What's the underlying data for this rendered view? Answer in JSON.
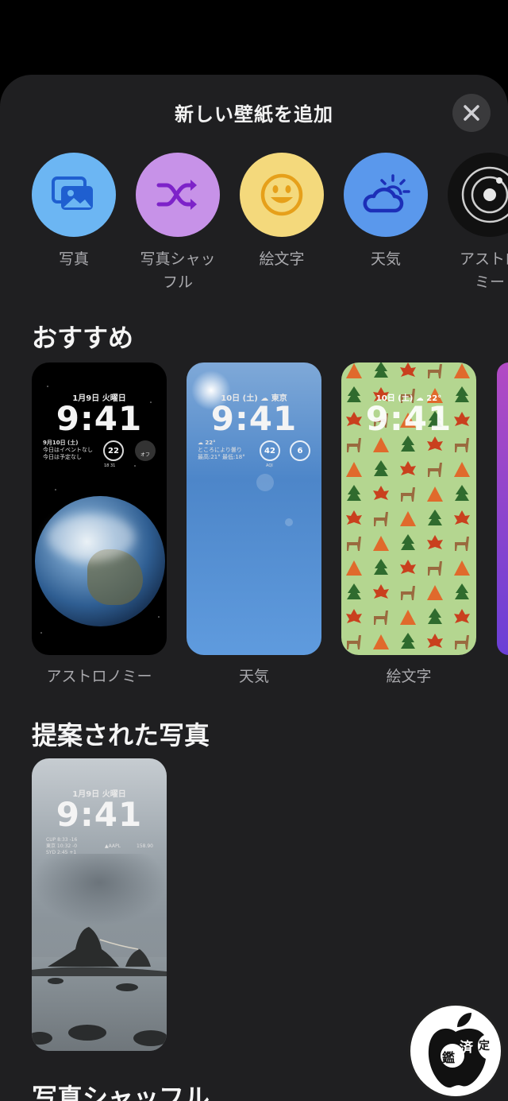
{
  "sheet": {
    "title": "新しい壁紙を追加",
    "close_icon": "xmark-icon"
  },
  "categories": [
    {
      "label": "写真",
      "icon": "photos-icon",
      "color": "#6cb6f3"
    },
    {
      "label": "写真シャッフル",
      "label_line1": "写真シャッ",
      "label_line2": "フル",
      "icon": "shuffle-icon",
      "color": "#c792e8"
    },
    {
      "label": "絵文字",
      "icon": "smiley-icon",
      "color": "#f4d97c"
    },
    {
      "label": "天気",
      "icon": "cloud-sun-icon",
      "color": "#5a98ec"
    },
    {
      "label": "アストロノミー",
      "label_line1": "アストロ",
      "label_line2": "ミー",
      "icon": "orbit-icon",
      "color": "#111111"
    }
  ],
  "featured": {
    "title": "おすすめ",
    "cards": [
      {
        "label": "アストロノミー",
        "date": "1月9日 火曜日",
        "time": "9:41",
        "widget_date": "9月10日 (土)",
        "widget_line1": "今日はイベントなし",
        "widget_line2": "今日は予定なし",
        "ring_value": "22",
        "ring_sub": "18 31",
        "side_label": "オフ"
      },
      {
        "label": "天気",
        "date": "10日 (土) ☁ 東京",
        "time": "9:41",
        "weather_temp": "☁ 22°",
        "weather_line1": "ところにより曇り",
        "weather_line2": "最高:21° 最低:18°",
        "ring1_value": "42",
        "ring1_sub": "AQI",
        "ring2_value": "6"
      },
      {
        "label": "絵文字",
        "date": "10日 (土) ☁ 22°",
        "time": "9:41"
      }
    ]
  },
  "suggested": {
    "title": "提案された写真",
    "card": {
      "date": "1月9日 火曜日",
      "time": "9:41",
      "row1": "CUP   8:33   -16",
      "row2": "東京   10:32   -0",
      "row3": "SYD   2:45   +1",
      "stock_name": "▲AAPL",
      "stock_value": "158.90"
    }
  },
  "next_section": {
    "title": "写真シャッフル"
  },
  "watermark": {
    "text": "鑑",
    "text2": "済",
    "text3": "定"
  }
}
